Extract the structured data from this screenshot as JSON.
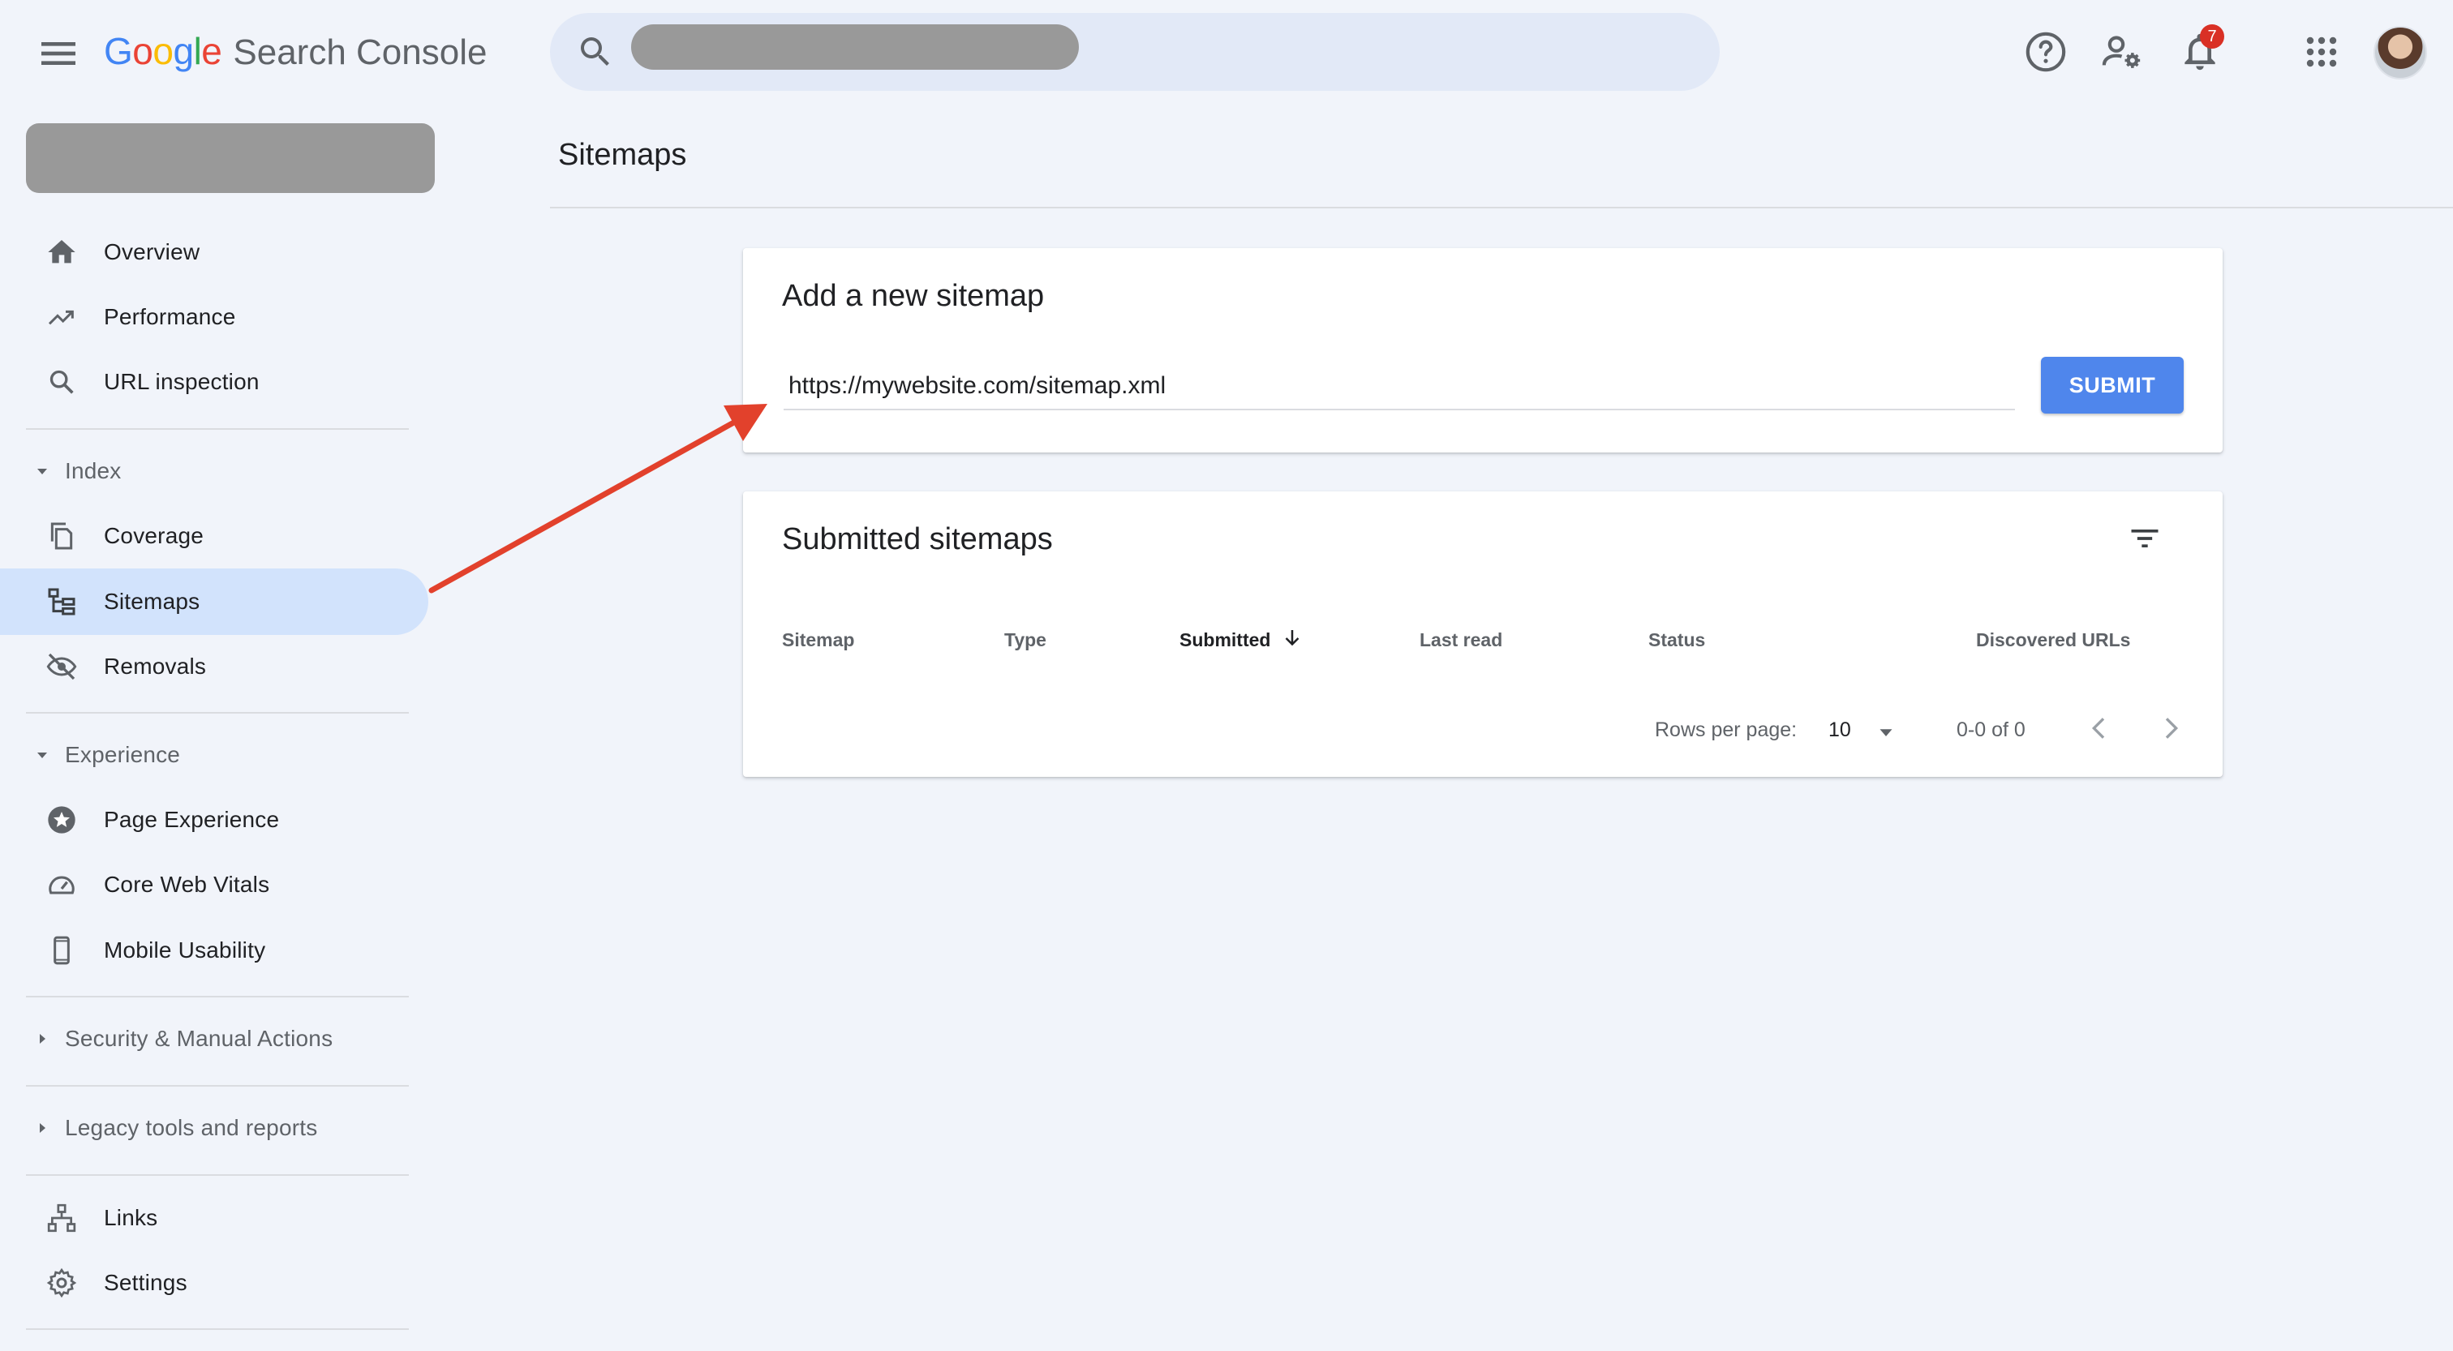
{
  "app": {
    "logo_letters": [
      "G",
      "o",
      "o",
      "g",
      "l",
      "e"
    ],
    "logo_colors": [
      "#4285F4",
      "#EA4335",
      "#FBBC05",
      "#4285F4",
      "#34A853",
      "#EA4335"
    ],
    "product_name": "Search Console"
  },
  "header": {
    "notification_count": "7"
  },
  "sidebar": {
    "items_top": [
      {
        "label": "Overview",
        "icon": "home-icon"
      },
      {
        "label": "Performance",
        "icon": "trending-up-icon"
      },
      {
        "label": "URL inspection",
        "icon": "search-icon"
      }
    ],
    "index": {
      "label": "Index",
      "items": [
        {
          "label": "Coverage",
          "icon": "copy-icon"
        },
        {
          "label": "Sitemaps",
          "icon": "sitemap-icon",
          "active": true
        },
        {
          "label": "Removals",
          "icon": "eye-off-icon"
        }
      ]
    },
    "experience": {
      "label": "Experience",
      "items": [
        {
          "label": "Page Experience",
          "icon": "star-badge-icon"
        },
        {
          "label": "Core Web Vitals",
          "icon": "speedometer-icon"
        },
        {
          "label": "Mobile Usability",
          "icon": "smartphone-icon"
        }
      ]
    },
    "security": {
      "label": "Security & Manual Actions"
    },
    "legacy": {
      "label": "Legacy tools and reports"
    },
    "items_bottom": [
      {
        "label": "Links",
        "icon": "links-icon"
      },
      {
        "label": "Settings",
        "icon": "gear-icon"
      }
    ]
  },
  "main": {
    "page_title": "Sitemaps",
    "add_card": {
      "title": "Add a new sitemap",
      "input_value": "https://mywebsite.com/sitemap.xml",
      "submit_label": "SUBMIT"
    },
    "submitted_card": {
      "title": "Submitted sitemaps",
      "columns": [
        "Sitemap",
        "Type",
        "Submitted",
        "Last read",
        "Status",
        "Discovered URLs"
      ],
      "sorted_column": "Submitted",
      "rows": [],
      "pagination": {
        "rows_per_page_label": "Rows per page:",
        "rows_per_page_value": "10",
        "range": "0-0 of 0"
      }
    }
  },
  "colors": {
    "accent": "#4f86ec",
    "active_nav": "#d2e3fc",
    "annotation_arrow": "#e2412c"
  }
}
